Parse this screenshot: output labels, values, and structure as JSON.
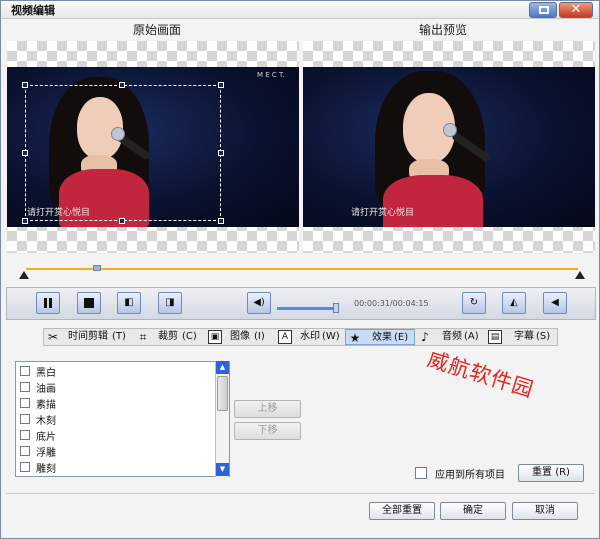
{
  "window": {
    "title": "视频编辑"
  },
  "panels": {
    "original_label": "原始画面",
    "output_label": "输出预览",
    "caption_text": "请打开赏心悦目",
    "logo_text": "M E C T."
  },
  "player": {
    "timecode": "00:00:31/00:04:15",
    "volume_level": 0.85,
    "playhead_fraction": 0.13
  },
  "tabs": [
    {
      "label": "时间剪辑",
      "key": "(T)",
      "icon": "scissors-icon"
    },
    {
      "label": "裁剪",
      "key": "(C)",
      "icon": "crop-icon"
    },
    {
      "label": "图像",
      "key": "(I)",
      "icon": "image-icon"
    },
    {
      "label": "水印",
      "key": "(W)",
      "icon": "watermark-icon"
    },
    {
      "label": "效果",
      "key": "(E)",
      "icon": "star-icon",
      "active": true
    },
    {
      "label": "音频",
      "key": "(A)",
      "icon": "music-note-icon"
    },
    {
      "label": "字幕",
      "key": "(S)",
      "icon": "subtitle-icon"
    }
  ],
  "effects": [
    "黑白",
    "油画",
    "素描",
    "木刻",
    "底片",
    "浮雕",
    "雕刻"
  ],
  "buttons": {
    "move_up": "上移",
    "move_down": "下移",
    "apply_all": "应用到所有项目",
    "reset": "重置",
    "reset_key": "(R)",
    "reset_all": "全部重置",
    "ok": "确定",
    "cancel": "取消"
  },
  "watermark_text": "威航软件园",
  "colors": {
    "timeline": "#f2b01e",
    "active_tab": "#c9dcf5",
    "watermark": "#e3251c",
    "scrollbar": "#2f64d8"
  }
}
